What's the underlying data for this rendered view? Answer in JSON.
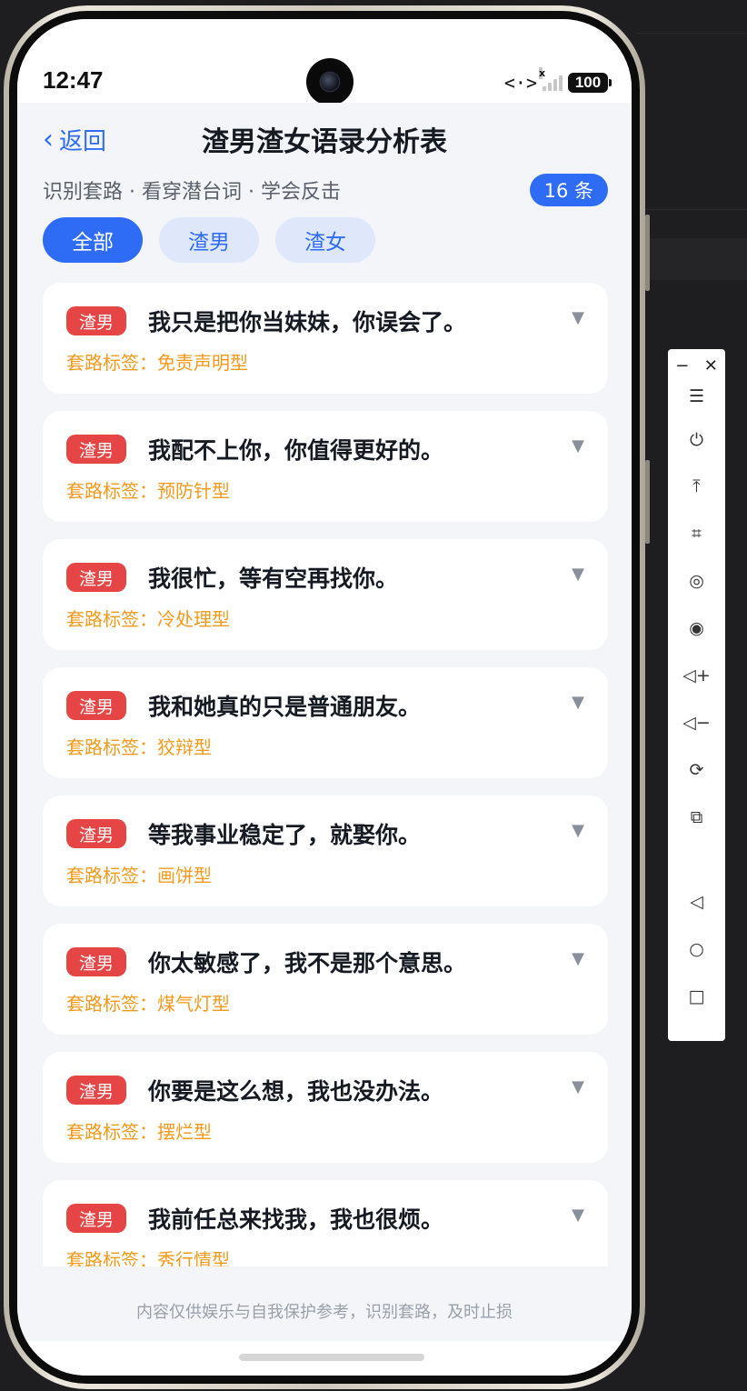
{
  "status": {
    "time": "12:47",
    "network": "<·>",
    "signal_x": "x",
    "battery": "100"
  },
  "header": {
    "back_label": "返回",
    "back_chevron": "‹",
    "title": "渣男渣女语录分析表"
  },
  "subtitle": "识别套路 · 看穿潜台词 · 学会反击",
  "count_badge": "16 条",
  "filters": [
    {
      "label": "全部",
      "active": true
    },
    {
      "label": "渣男",
      "active": false
    },
    {
      "label": "渣女",
      "active": false
    }
  ],
  "cards": [
    {
      "tag": "渣男",
      "quote": "我只是把你当妹妹，你误会了。",
      "label": "套路标签：免责声明型"
    },
    {
      "tag": "渣男",
      "quote": "我配不上你，你值得更好的。",
      "label": "套路标签：预防针型"
    },
    {
      "tag": "渣男",
      "quote": "我很忙，等有空再找你。",
      "label": "套路标签：冷处理型"
    },
    {
      "tag": "渣男",
      "quote": "我和她真的只是普通朋友。",
      "label": "套路标签：狡辩型"
    },
    {
      "tag": "渣男",
      "quote": "等我事业稳定了，就娶你。",
      "label": "套路标签：画饼型"
    },
    {
      "tag": "渣男",
      "quote": "你太敏感了，我不是那个意思。",
      "label": "套路标签：煤气灯型"
    },
    {
      "tag": "渣男",
      "quote": "你要是这么想，我也没办法。",
      "label": "套路标签：摆烂型"
    },
    {
      "tag": "渣男",
      "quote": "我前任总来找我，我也很烦。",
      "label": "套路标签：秀行情型"
    }
  ],
  "expand_icon": "▼",
  "footer_note": "内容仅供娱乐与自我保护参考，识别套路，及时止损",
  "toolbar": {
    "minimize": "−",
    "close": "✕",
    "items": [
      {
        "name": "menu-icon",
        "glyph": "☰"
      },
      {
        "name": "power-icon",
        "glyph": "⏻"
      },
      {
        "name": "upload-icon",
        "glyph": "⤒"
      },
      {
        "name": "crop-icon",
        "glyph": "⌗"
      },
      {
        "name": "screenshot-icon",
        "glyph": "◎"
      },
      {
        "name": "record-icon",
        "glyph": "◉"
      },
      {
        "name": "volume-up-icon",
        "glyph": "◁+"
      },
      {
        "name": "volume-down-icon",
        "glyph": "◁−"
      },
      {
        "name": "rotate-icon",
        "glyph": "⟳"
      },
      {
        "name": "devices-icon",
        "glyph": "⧉"
      },
      {
        "name": "nav-back-icon",
        "glyph": "◁"
      },
      {
        "name": "nav-home-icon",
        "glyph": "○"
      },
      {
        "name": "nav-recents-icon",
        "glyph": "□"
      }
    ]
  },
  "colors": {
    "accent": "#2f6cf6",
    "tag": "#e64545",
    "label": "#f39a1d"
  }
}
